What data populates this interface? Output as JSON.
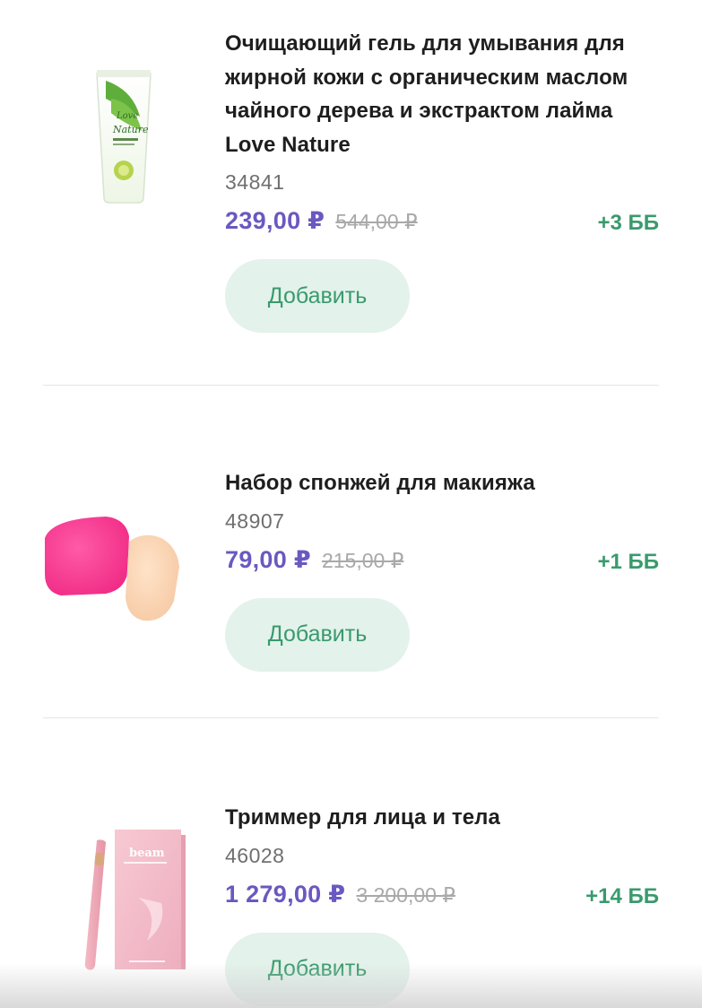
{
  "products": [
    {
      "title": "Очищающий гель для умывания для жирной кожи с органическим маслом чайного дерева и экстрактом лайма Love Nature",
      "sku": "34841",
      "price": "239,00 ₽",
      "old_price": "544,00 ₽",
      "bonus": "+3 ББ",
      "button": "Добавить",
      "image_icon": "cleansing-gel-tube-image"
    },
    {
      "title": "Набор спонжей для макияжа",
      "sku": "48907",
      "price": "79,00 ₽",
      "old_price": "215,00 ₽",
      "bonus": "+1 ББ",
      "button": "Добавить",
      "image_icon": "makeup-sponges-image"
    },
    {
      "title": "Триммер для лица и тела",
      "sku": "46028",
      "price": "1 279,00 ₽",
      "old_price": "3 200,00 ₽",
      "bonus": "+14 ББ",
      "button": "Добавить",
      "image_icon": "trimmer-box-image"
    }
  ],
  "colors": {
    "price": "#6b58c0",
    "bonus": "#3a9a6d",
    "button_bg": "#e3f2eb"
  }
}
